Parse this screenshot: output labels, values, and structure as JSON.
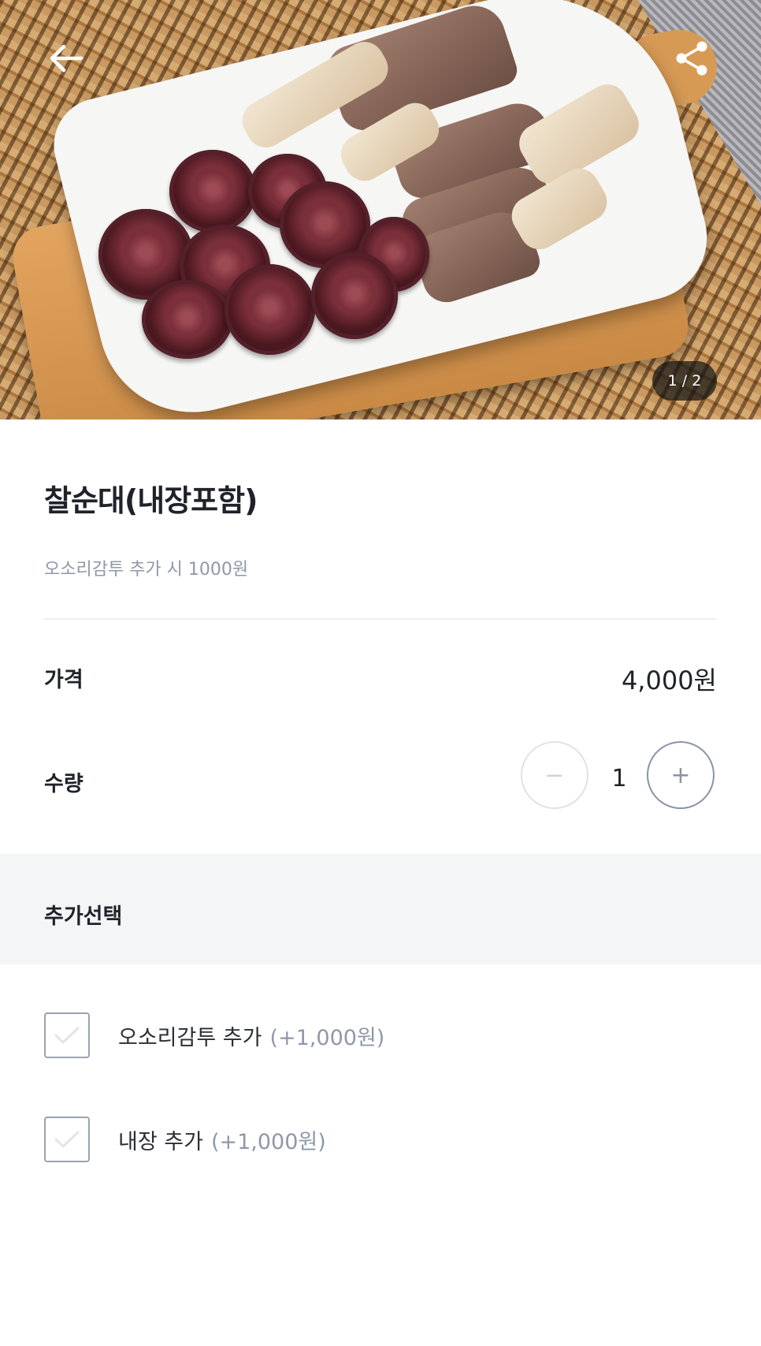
{
  "hero": {
    "page_indicator": "1 / 2",
    "icons": {
      "back": "arrow-left-icon",
      "share": "share-icon"
    }
  },
  "product": {
    "title": "찰순대(내장포함)",
    "description": "오소리감투 추가 시 1000원"
  },
  "price": {
    "label": "가격",
    "value": "4,000원"
  },
  "quantity": {
    "label": "수량",
    "minus": "−",
    "value": "1",
    "plus": "+"
  },
  "options": {
    "section_title": "추가선택",
    "items": [
      {
        "label": "오소리감투 추가",
        "price": "(+1,000원)",
        "checked": false
      },
      {
        "label": "내장 추가",
        "price": "(+1,000원)",
        "checked": false
      }
    ]
  },
  "colors": {
    "text_primary": "#1f2329",
    "text_secondary": "#8e98a8",
    "section_bg": "#f4f5f7",
    "divider": "#eceef2"
  }
}
